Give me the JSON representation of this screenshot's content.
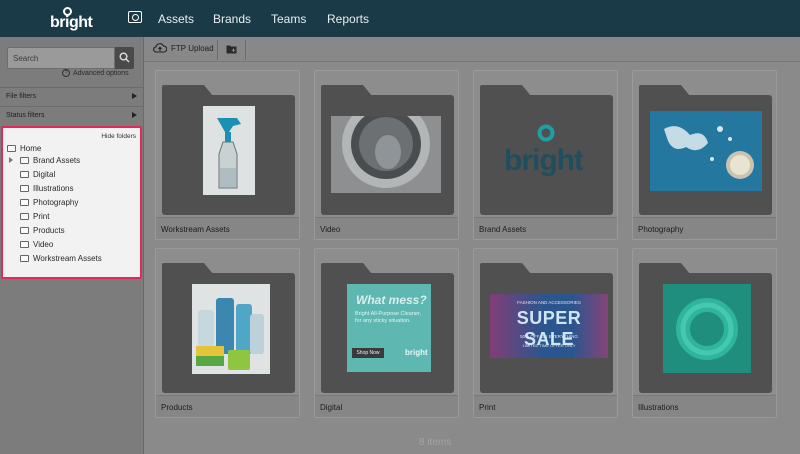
{
  "nav": {
    "logo": "bright",
    "items": [
      "Assets",
      "Brands",
      "Teams",
      "Reports"
    ]
  },
  "sidebar": {
    "search_placeholder": "Search",
    "advanced_options": "Advanced options",
    "file_filters": "File filters",
    "status_filters": "Status filters",
    "hide_folders": "Hide folders",
    "tree": [
      "Home",
      "Brand Assets",
      "Digital",
      "Illustrations",
      "Photography",
      "Print",
      "Products",
      "Video",
      "Workstream Assets"
    ]
  },
  "toolbar": {
    "ftp_upload": "FTP Upload"
  },
  "grid": {
    "cards": [
      "Workstream Assets",
      "Video",
      "Brand Assets",
      "Photography",
      "Products",
      "Digital",
      "Print",
      "Illustrations"
    ],
    "digital_ad": {
      "headline": "What mess?",
      "body": "Bright All-Purpose Cleaner, for any sticky situation.",
      "cta": "Shop Now",
      "brand": "bright"
    },
    "print_ad": {
      "top": "FASHION AND ACCESSORIES",
      "headline": "SUPER SALE",
      "sub": "50% OFF ON EVERYTHING",
      "fine": "LIMITED TIME OFFER ONLY"
    },
    "brand_logo": "bright"
  },
  "footer": {
    "items_count": "8 items"
  },
  "colors": {
    "topbar": "#1b3a47",
    "highlight": "#e4285e",
    "teal": "#2bb3b1"
  }
}
